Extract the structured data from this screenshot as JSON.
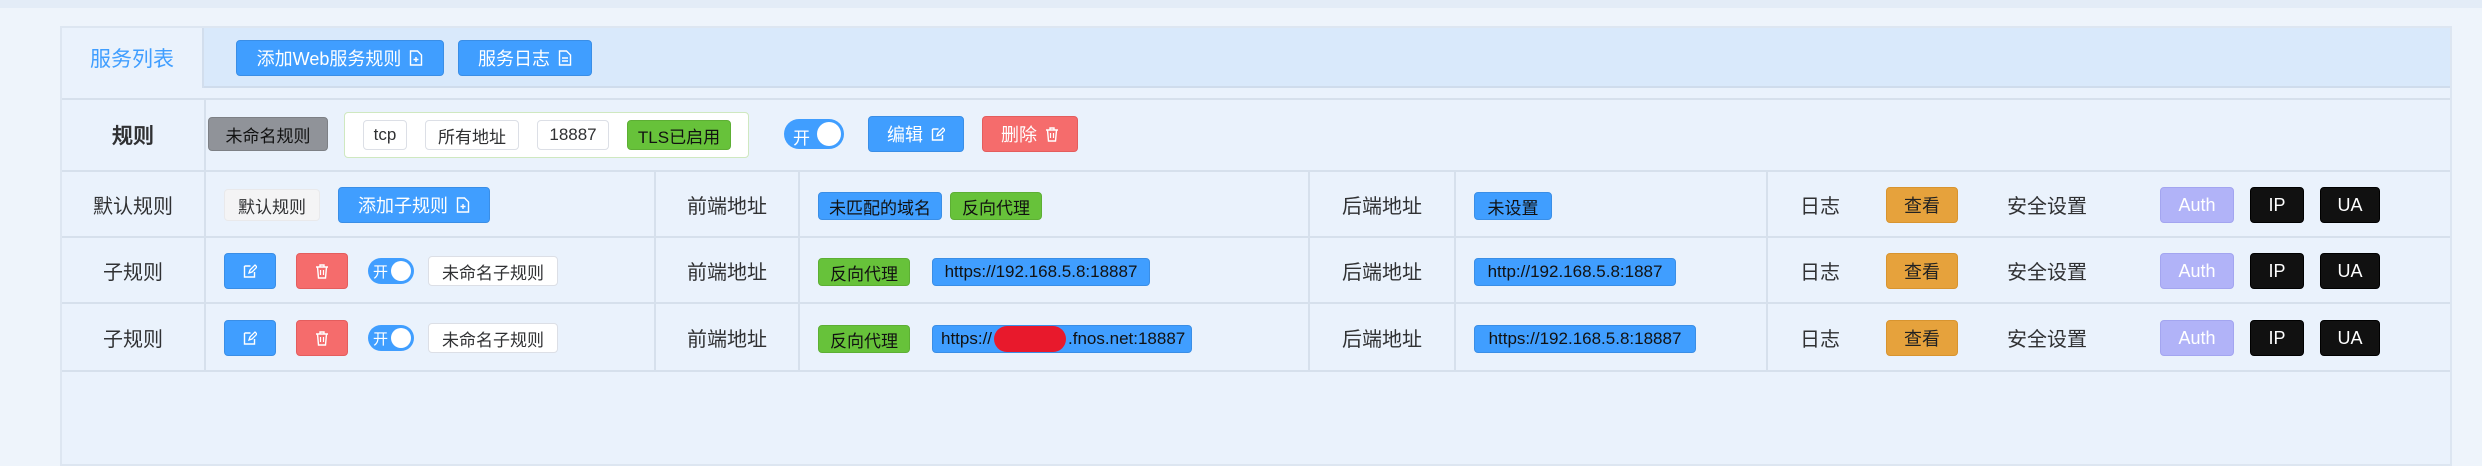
{
  "tabs": {
    "active": "服务列表",
    "add_web_rule": "添加Web服务规则",
    "service_log": "服务日志"
  },
  "rule": {
    "header": "规则",
    "name": "未命名规则",
    "protocol": "tcp",
    "address": "所有地址",
    "port": "18887",
    "tls": "TLS已启用",
    "switch": "开",
    "edit": "编辑",
    "delete": "删除"
  },
  "default_row": {
    "label": "默认规则",
    "name": "默认规则",
    "add_sub": "添加子规则",
    "frontend_label": "前端地址",
    "tags": [
      "未匹配的域名",
      "反向代理"
    ],
    "backend_label": "后端地址",
    "backend": "未设置",
    "log_label": "日志",
    "view": "查看",
    "security_label": "安全设置",
    "auth": "Auth",
    "ip": "IP",
    "ua": "UA"
  },
  "sub_rows": [
    {
      "label": "子规则",
      "switch": "开",
      "name": "未命名子规则",
      "frontend_label": "前端地址",
      "type": "反向代理",
      "frontend": "https://192.168.5.8:18887",
      "backend_label": "后端地址",
      "backend": "http://192.168.5.8:1887",
      "log_label": "日志",
      "view": "查看",
      "security_label": "安全设置",
      "auth": "Auth",
      "ip": "IP",
      "ua": "UA"
    },
    {
      "label": "子规则",
      "switch": "开",
      "name": "未命名子规则",
      "frontend_label": "前端地址",
      "type": "反向代理",
      "frontend": "https://",
      "frontend_suffix": ".fnos.net:18887",
      "backend_label": "后端地址",
      "backend": "https://192.168.5.8:18887",
      "log_label": "日志",
      "view": "查看",
      "security_label": "安全设置",
      "auth": "Auth",
      "ip": "IP",
      "ua": "UA"
    }
  ],
  "colors": {
    "primary": "#409eff",
    "danger": "#f56c6c",
    "warning": "#e6a23c",
    "success": "#67c23a",
    "auth": "#b1b3f8",
    "redaction": "#e8192c"
  }
}
